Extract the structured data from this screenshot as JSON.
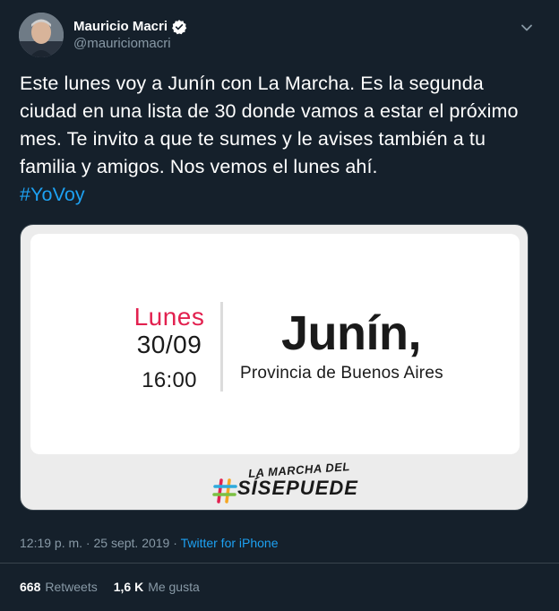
{
  "author": {
    "name": "Mauricio Macri",
    "handle": "@mauriciomacri"
  },
  "tweet": {
    "text": "Este lunes voy a Junín con La Marcha. Es la segunda ciudad en una lista de 30 donde vamos a estar el próximo mes. Te invito a que te sumes y le avises también a tu familia y amigos. Nos vemos el lunes ahí.",
    "hashtag": "#YoVoy"
  },
  "media": {
    "day": "Lunes",
    "date": "30/09",
    "time": "16:00",
    "city": "Junín,",
    "province": "Provincia de Buenos Aires",
    "brand_top": "LA MARCHA DEL",
    "brand_name": "SÍSEPUEDE"
  },
  "meta": {
    "time": "12:19 p. m.",
    "separator": " · ",
    "date": "25 sept. 2019",
    "separator2": " · ",
    "source": "Twitter for iPhone"
  },
  "stats": {
    "retweets_count": "668",
    "retweets_label": "Retweets",
    "likes_count": "1,6 K",
    "likes_label": "Me gusta"
  },
  "colors": {
    "background": "#15202b",
    "accent": "#1da1f2",
    "secondary_text": "#8899a6",
    "day_red": "#e2214f"
  },
  "icons": {
    "verified": "verified-badge-icon",
    "caret": "chevron-down-icon",
    "hash": "hashtag-logo-icon"
  }
}
